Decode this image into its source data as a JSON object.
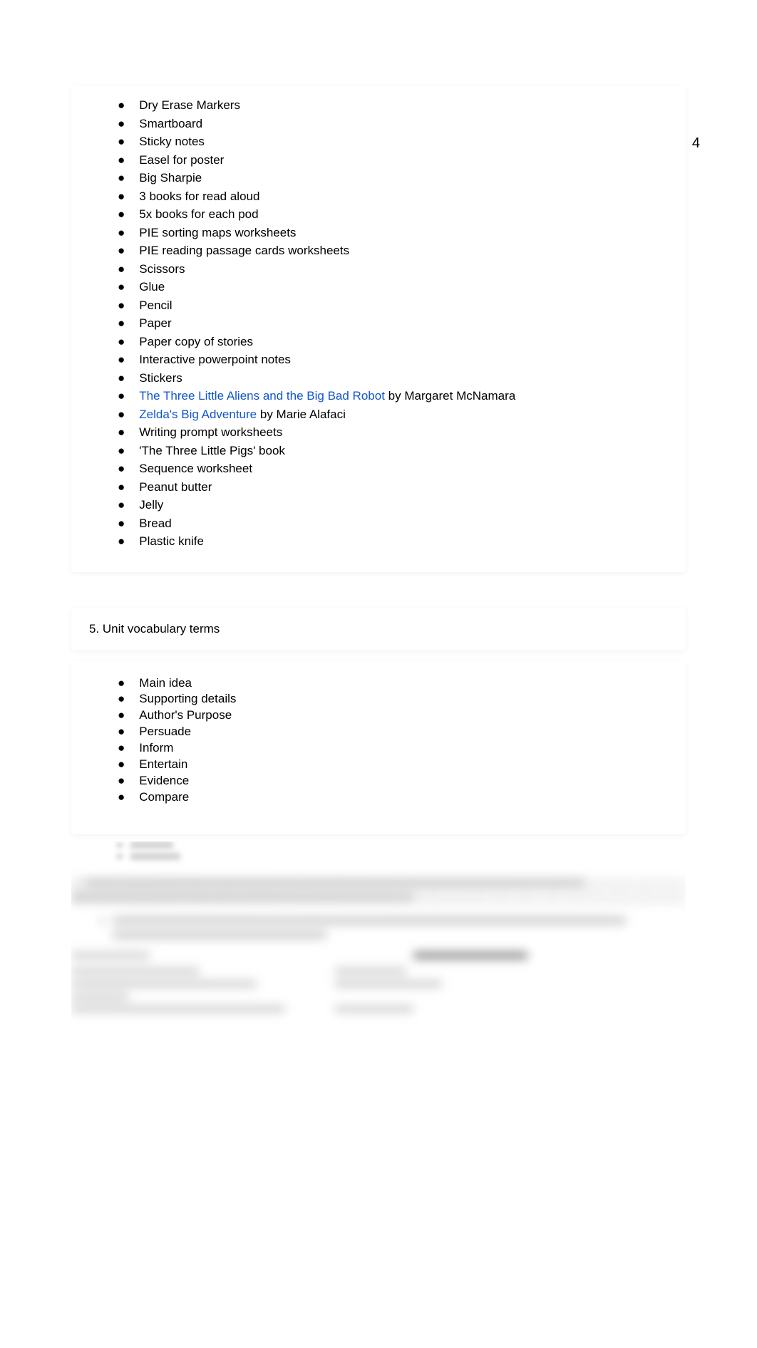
{
  "pageNumber": "4",
  "materials": {
    "items": [
      {
        "text": "Dry Erase Markers",
        "type": "plain"
      },
      {
        "text": "Smartboard",
        "type": "plain"
      },
      {
        "text": "Sticky notes",
        "type": "plain"
      },
      {
        "text": "Easel for poster",
        "type": "plain"
      },
      {
        "text": "Big Sharpie",
        "type": "plain"
      },
      {
        "text": "3 books for read aloud",
        "type": "plain"
      },
      {
        "text": "5x books for each pod",
        "type": "plain"
      },
      {
        "text": "PIE sorting maps worksheets",
        "type": "plain"
      },
      {
        "text": "PIE reading passage cards worksheets",
        "type": "plain"
      },
      {
        "text": "Scissors",
        "type": "plain"
      },
      {
        "text": "Glue",
        "type": "plain"
      },
      {
        "text": "Pencil",
        "type": "plain"
      },
      {
        "text": "Paper",
        "type": "plain"
      },
      {
        "text": "Paper copy of stories",
        "type": "plain"
      },
      {
        "text": "Interactive powerpoint notes",
        "type": "plain"
      },
      {
        "text": "Stickers",
        "type": "plain"
      },
      {
        "linkText": "The Three Little Aliens and the Big Bad Robot",
        "suffix": " by Margaret McNamara",
        "type": "link"
      },
      {
        "linkText": "Zelda's Big Adventure",
        "suffix": " by Marie Alafaci",
        "type": "link"
      },
      {
        "text": "Writing prompt worksheets",
        "type": "plain"
      },
      {
        "text": "'The Three Little Pigs' book",
        "type": "plain"
      },
      {
        "text": "Sequence worksheet",
        "type": "plain"
      },
      {
        "text": "Peanut butter",
        "type": "plain"
      },
      {
        "text": "Jelly",
        "type": "plain"
      },
      {
        "text": "Bread",
        "type": "plain"
      },
      {
        "text": "Plastic knife",
        "type": "plain"
      }
    ]
  },
  "sectionHeader": "5. Unit vocabulary terms",
  "vocabulary": {
    "items": [
      "Main idea",
      "Supporting details",
      "Author's Purpose",
      "Persuade",
      "Inform",
      "Entertain",
      "Evidence",
      "Compare"
    ]
  },
  "bulletChar": "●"
}
